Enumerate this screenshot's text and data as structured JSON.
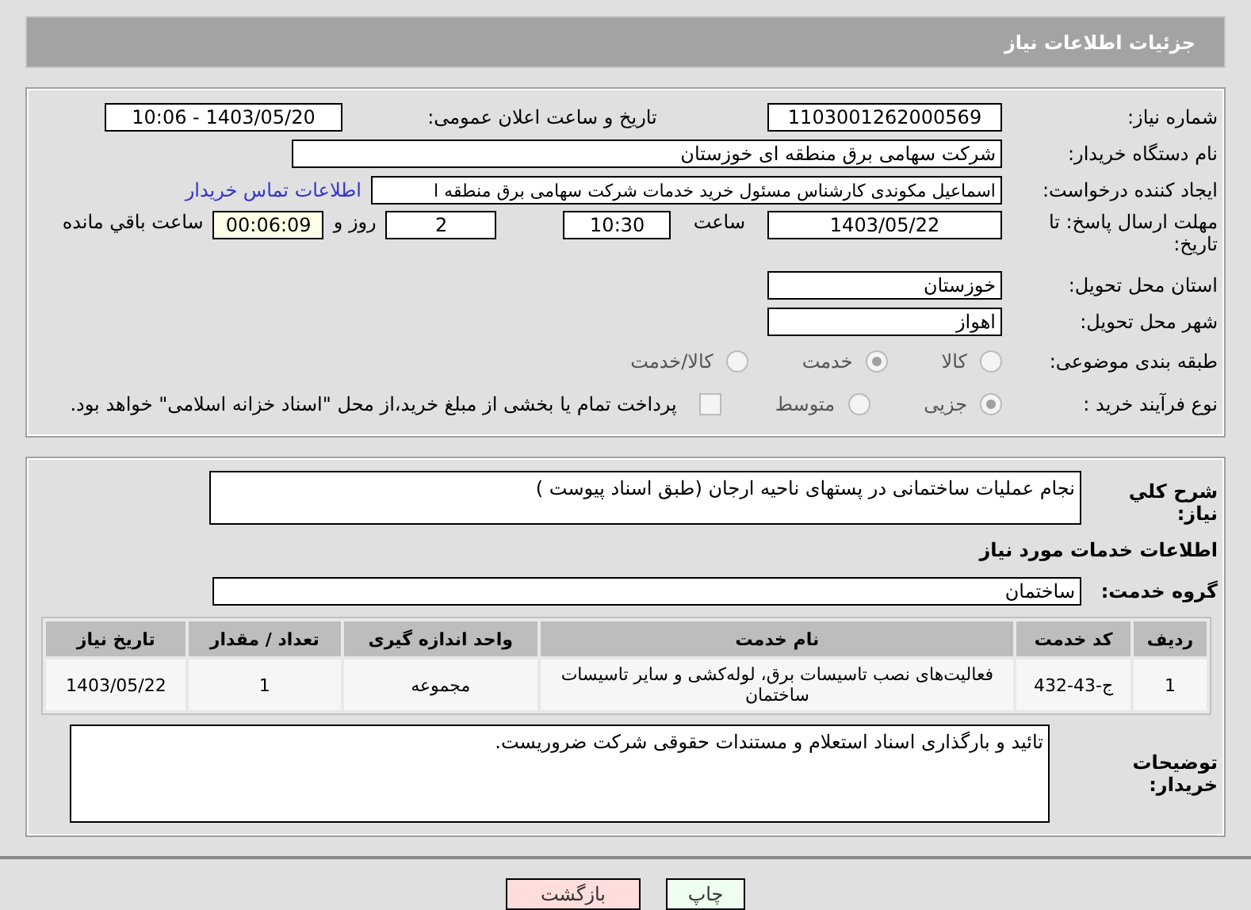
{
  "header": {
    "title": "جزئیات اطلاعات نیاز"
  },
  "details": {
    "need_number": {
      "label": "شماره نیاز:",
      "value": "1103001262000569"
    },
    "announce": {
      "label": "تاریخ و ساعت اعلان عمومی:",
      "value": "1403/05/20 - 10:06"
    },
    "buyer": {
      "label": "نام دستگاه خریدار:",
      "value": "شرکت سهامی برق منطقه ای خوزستان"
    },
    "creator": {
      "label": "ایجاد کننده درخواست:",
      "value": "اسماعیل مکوندی کارشناس مسئول خرید خدمات شرکت سهامی برق منطقه ا",
      "link": "اطلاعات تماس خریدار"
    },
    "deadline": {
      "label": "مهلت ارسال پاسخ: تا تاریخ:",
      "date": "1403/05/22",
      "time_label": "ساعت",
      "time": "10:30",
      "days": "2",
      "days_label": "روز و",
      "remaining": "00:06:09",
      "remaining_label": "ساعت باقي مانده"
    },
    "province": {
      "label": "استان محل تحویل:",
      "value": "خوزستان"
    },
    "city": {
      "label": "شهر محل تحویل:",
      "value": "اهواز"
    },
    "category": {
      "label": "طبقه بندی موضوعی:",
      "options": [
        {
          "label": "کالا",
          "selected": false
        },
        {
          "label": "خدمت",
          "selected": true
        },
        {
          "label": "کالا/خدمت",
          "selected": false
        }
      ]
    },
    "process": {
      "label": "نوع فرآیند خرید :",
      "options": [
        {
          "label": "جزیی",
          "selected": true
        },
        {
          "label": "متوسط",
          "selected": false
        }
      ],
      "payment": {
        "checked": false,
        "text": "پرداخت تمام یا بخشی از مبلغ خرید،از محل \"اسناد خزانه اسلامی\" خواهد بود."
      }
    }
  },
  "services": {
    "description": {
      "label": "شرح کلي نياز:",
      "value": "نجام عملیات ساختمانی در پستهای ناحیه ارجان  (طبق اسناد  پیوست )"
    },
    "section_title": "اطلاعات خدمات مورد نیاز",
    "group": {
      "label": "گروه خدمت:",
      "value": "ساختمان"
    },
    "table": {
      "columns": [
        "ردیف",
        "کد خدمت",
        "نام خدمت",
        "واحد اندازه گیری",
        "تعداد / مقدار",
        "تاریخ نیاز"
      ],
      "rows": [
        [
          "1",
          "ج-43-432",
          "فعالیت‌های نصب تاسیسات برق، لوله‌کشی و سایر تاسیسات ساختمان",
          "مجموعه",
          "1",
          "1403/05/22"
        ]
      ]
    },
    "buyer_notes": {
      "label": "توضیحات خریدار:",
      "value": "تائید و بارگذاری اسناد استعلام و مستندات حقوقی شرکت ضروریست."
    }
  },
  "buttons": [
    {
      "label": "چاپ",
      "kind": "print"
    },
    {
      "label": "بازگشت",
      "kind": "back"
    }
  ]
}
